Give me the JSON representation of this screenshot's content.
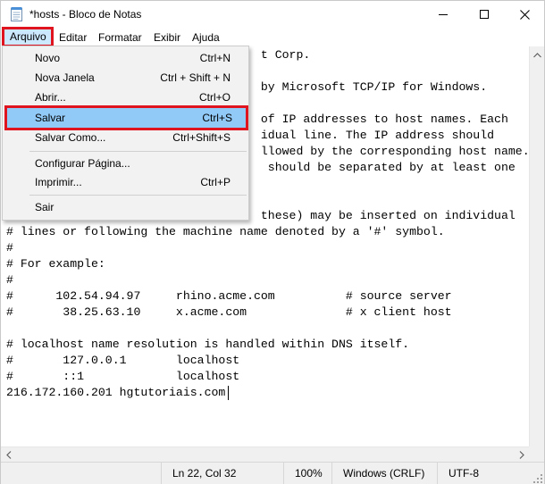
{
  "window": {
    "title": "*hosts - Bloco de Notas"
  },
  "menubar": {
    "items": [
      "Arquivo",
      "Editar",
      "Formatar",
      "Exibir",
      "Ajuda"
    ]
  },
  "file_menu": {
    "items": [
      {
        "label": "Novo",
        "shortcut": "Ctrl+N"
      },
      {
        "label": "Nova Janela",
        "shortcut": "Ctrl + Shift + N"
      },
      {
        "label": "Abrir...",
        "shortcut": "Ctrl+O"
      },
      {
        "label": "Salvar",
        "shortcut": "Ctrl+S"
      },
      {
        "label": "Salvar Como...",
        "shortcut": "Ctrl+Shift+S"
      },
      {
        "label": "Configurar Página...",
        "shortcut": ""
      },
      {
        "label": "Imprimir...",
        "shortcut": "Ctrl+P"
      },
      {
        "label": "Sair",
        "shortcut": ""
      }
    ],
    "highlighted": "Salvar"
  },
  "editor": {
    "lines": [
      "                                    t Corp.",
      "",
      "                                    by Microsoft TCP/IP for Windows.",
      "",
      "                                    of IP addresses to host names. Each",
      "                                    idual line. The IP address should",
      "                                    llowed by the corresponding host name.",
      "                                     should be separated by at least one",
      "",
      "",
      "                                    these) may be inserted on individual",
      "# lines or following the machine name denoted by a '#' symbol.",
      "#",
      "# For example:",
      "#",
      "#      102.54.94.97     rhino.acme.com          # source server",
      "#       38.25.63.10     x.acme.com              # x client host",
      "",
      "# localhost name resolution is handled within DNS itself.",
      "#       127.0.0.1       localhost",
      "#       ::1             localhost",
      "216.172.160.201 hgtutoriais.com"
    ]
  },
  "statusbar": {
    "position": "Ln 22, Col 32",
    "zoom": "100%",
    "line_ending": "Windows (CRLF)",
    "encoding": "UTF-8"
  },
  "icons": {
    "app": "notepad-icon",
    "minimize": "minimize-icon",
    "maximize": "maximize-icon",
    "close": "close-icon"
  },
  "colors": {
    "highlight_box": "#e0141e",
    "menu_hover": "#91c9f7",
    "menu_active": "#cce8ff"
  }
}
